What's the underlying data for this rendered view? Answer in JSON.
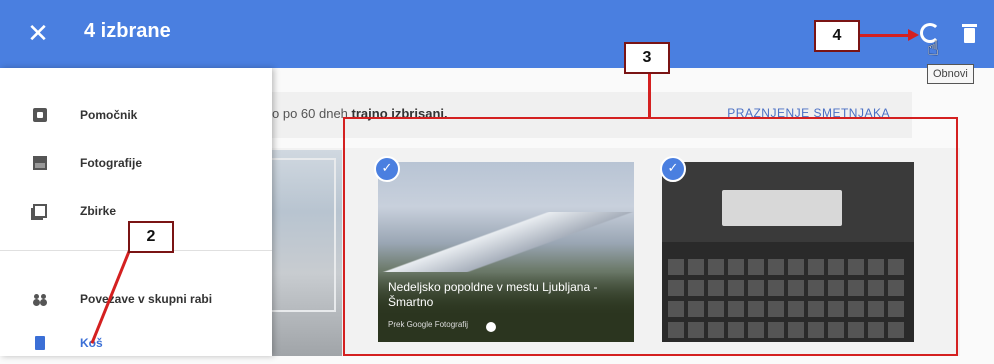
{
  "topbar": {
    "close_icon": "close-icon",
    "selection_title": "4 izbrane",
    "refresh_tooltip": "Obnovi",
    "background_color": "#4a7fe0"
  },
  "banner": {
    "text_normal": "o po 60 dneh",
    "text_bold": "trajno izbrisani.",
    "empty_trash_label": "PRAZNJENJE SMETNJAKA"
  },
  "drawer": {
    "items": [
      {
        "label": "Pomočnik",
        "icon": "assistant-icon"
      },
      {
        "label": "Fotografije",
        "icon": "photos-icon"
      },
      {
        "label": "Zbirke",
        "icon": "albums-icon"
      },
      {
        "label": "Povezave v skupni rabi",
        "icon": "shared-links-icon"
      },
      {
        "label": "Koš",
        "icon": "trash-icon"
      }
    ]
  },
  "photos": [
    {
      "caption": "Nedeljsko popoldne v mestu Ljubljana - Šmartno",
      "sub": "Prek Google Fotografij"
    }
  ],
  "annotations": {
    "label_2": "2",
    "label_3": "3",
    "label_4": "4",
    "color": "#d42020"
  }
}
